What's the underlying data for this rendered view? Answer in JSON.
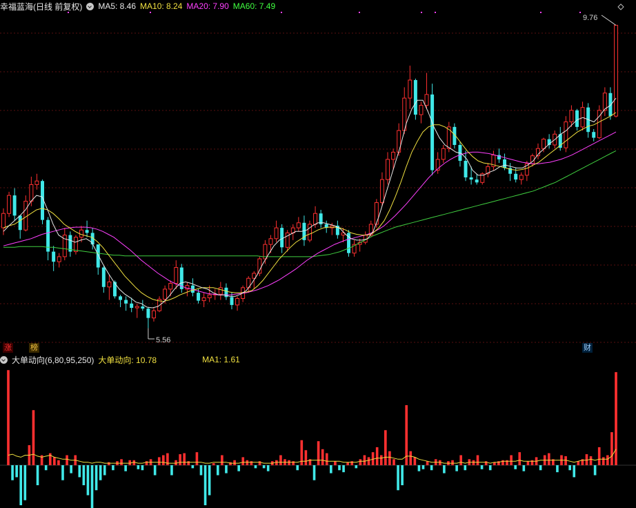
{
  "header": {
    "title": "幸福蓝海(日线 前复权)",
    "ma5": "MA5: 8.46",
    "ma10": "MA10: 8.24",
    "ma20": "MA20: 7.90",
    "ma60": "MA60: 7.49"
  },
  "markers": {
    "zhang": "涨",
    "bang": "榜",
    "cai": "财"
  },
  "price_labels": {
    "high": "9.76",
    "low": "5.56"
  },
  "sub_header": {
    "title": "大单动向(6,80,95,250)",
    "value": "大单动向: 10.78",
    "ma": "MA1: 1.61"
  },
  "colors": {
    "up": "#ff3030",
    "down": "#40e8e8",
    "ma5": "#e8e8e8",
    "ma10": "#f0e040",
    "ma20": "#ff40ff",
    "ma60": "#40d040",
    "grid": "#5a1010"
  },
  "chart_data": {
    "type": "candlestick",
    "ohlc": [
      [
        6.95,
        7.22,
        6.85,
        7.15
      ],
      [
        7.15,
        7.45,
        7.1,
        7.4
      ],
      [
        7.4,
        7.5,
        7.05,
        7.12
      ],
      [
        7.12,
        7.1,
        6.8,
        6.92
      ],
      [
        6.92,
        7.4,
        6.9,
        7.32
      ],
      [
        7.32,
        7.66,
        7.25,
        7.55
      ],
      [
        7.55,
        7.7,
        7.48,
        7.6
      ],
      [
        7.6,
        7.62,
        7.0,
        7.06
      ],
      [
        7.06,
        7.1,
        6.5,
        6.62
      ],
      [
        6.62,
        6.7,
        6.35,
        6.48
      ],
      [
        6.48,
        6.6,
        6.4,
        6.55
      ],
      [
        6.55,
        6.95,
        6.5,
        6.85
      ],
      [
        6.85,
        6.9,
        6.55,
        6.62
      ],
      [
        6.62,
        6.85,
        6.58,
        6.82
      ],
      [
        6.82,
        6.98,
        6.75,
        6.92
      ],
      [
        6.92,
        7.05,
        6.82,
        6.88
      ],
      [
        6.88,
        6.95,
        6.65,
        6.72
      ],
      [
        6.72,
        6.72,
        6.3,
        6.4
      ],
      [
        6.4,
        6.42,
        6.05,
        6.13
      ],
      [
        6.13,
        6.3,
        5.95,
        6.2
      ],
      [
        6.2,
        6.22,
        5.97,
        6.0
      ],
      [
        6.0,
        6.02,
        5.85,
        5.95
      ],
      [
        5.95,
        6.0,
        5.8,
        5.9
      ],
      [
        5.9,
        5.98,
        5.78,
        5.84
      ],
      [
        5.84,
        5.9,
        5.7,
        5.86
      ],
      [
        5.86,
        5.95,
        5.8,
        5.83
      ],
      [
        5.83,
        5.85,
        5.56,
        5.7
      ],
      [
        5.7,
        5.85,
        5.65,
        5.8
      ],
      [
        5.8,
        6.0,
        5.78,
        5.96
      ],
      [
        5.96,
        6.15,
        5.9,
        6.1
      ],
      [
        6.1,
        6.22,
        6.0,
        6.18
      ],
      [
        6.18,
        6.5,
        6.1,
        6.4
      ],
      [
        6.4,
        6.45,
        6.05,
        6.1
      ],
      [
        6.1,
        6.2,
        6.0,
        6.15
      ],
      [
        6.15,
        6.25,
        6.0,
        6.05
      ],
      [
        6.05,
        6.1,
        5.9,
        5.94
      ],
      [
        5.94,
        6.05,
        5.85,
        5.98
      ],
      [
        5.98,
        6.15,
        5.92,
        6.02
      ],
      [
        6.02,
        6.1,
        5.95,
        6.03
      ],
      [
        6.03,
        6.2,
        5.95,
        6.12
      ],
      [
        6.12,
        6.18,
        5.95,
        5.99
      ],
      [
        5.99,
        6.05,
        5.82,
        5.88
      ],
      [
        5.88,
        6.0,
        5.8,
        5.97
      ],
      [
        5.97,
        6.15,
        5.92,
        6.12
      ],
      [
        6.12,
        6.28,
        6.05,
        6.25
      ],
      [
        6.25,
        6.35,
        6.1,
        6.32
      ],
      [
        6.32,
        6.55,
        6.28,
        6.52
      ],
      [
        6.52,
        6.78,
        6.45,
        6.72
      ],
      [
        6.72,
        6.85,
        6.6,
        6.8
      ],
      [
        6.8,
        7.05,
        6.75,
        6.95
      ],
      [
        6.95,
        7.0,
        6.6,
        6.68
      ],
      [
        6.68,
        6.92,
        6.62,
        6.88
      ],
      [
        6.88,
        7.0,
        6.78,
        6.95
      ],
      [
        6.95,
        7.1,
        6.9,
        7.02
      ],
      [
        7.02,
        7.12,
        6.7,
        6.78
      ],
      [
        6.78,
        7.05,
        6.75,
        7.0
      ],
      [
        7.0,
        7.25,
        6.95,
        7.15
      ],
      [
        7.15,
        7.2,
        6.95,
        7.0
      ],
      [
        7.0,
        7.05,
        6.88,
        6.95
      ],
      [
        6.95,
        7.02,
        6.85,
        6.98
      ],
      [
        6.98,
        7.05,
        6.8,
        6.85
      ],
      [
        6.85,
        6.95,
        6.75,
        6.88
      ],
      [
        6.88,
        6.92,
        6.55,
        6.6
      ],
      [
        6.6,
        6.78,
        6.55,
        6.72
      ],
      [
        6.72,
        6.8,
        6.62,
        6.75
      ],
      [
        6.75,
        6.9,
        6.72,
        6.85
      ],
      [
        6.85,
        7.05,
        6.82,
        7.0
      ],
      [
        7.0,
        7.35,
        6.95,
        7.3
      ],
      [
        7.3,
        7.72,
        7.25,
        7.62
      ],
      [
        7.62,
        8.0,
        7.55,
        7.9
      ],
      [
        7.9,
        8.05,
        7.75,
        8.0
      ],
      [
        8.0,
        8.4,
        7.95,
        8.3
      ],
      [
        8.3,
        8.9,
        8.25,
        8.75
      ],
      [
        8.75,
        9.2,
        8.6,
        9.0
      ],
      [
        9.0,
        9.02,
        8.45,
        8.52
      ],
      [
        8.52,
        8.7,
        8.4,
        8.65
      ],
      [
        8.65,
        9.1,
        8.6,
        8.8
      ],
      [
        8.8,
        8.95,
        7.68,
        7.75
      ],
      [
        7.75,
        8.0,
        7.7,
        7.9
      ],
      [
        7.9,
        8.1,
        7.85,
        8.05
      ],
      [
        8.05,
        8.42,
        8.0,
        8.35
      ],
      [
        8.35,
        8.4,
        8.05,
        8.1
      ],
      [
        8.1,
        8.15,
        7.8,
        7.88
      ],
      [
        7.88,
        8.02,
        7.6,
        7.65
      ],
      [
        7.65,
        7.8,
        7.55,
        7.62
      ],
      [
        7.62,
        7.7,
        7.55,
        7.58
      ],
      [
        7.58,
        7.72,
        7.55,
        7.7
      ],
      [
        7.7,
        7.85,
        7.65,
        7.8
      ],
      [
        7.8,
        8.02,
        7.75,
        7.96
      ],
      [
        7.96,
        8.05,
        7.85,
        7.9
      ],
      [
        7.9,
        7.98,
        7.75,
        7.78
      ],
      [
        7.78,
        7.85,
        7.6,
        7.7
      ],
      [
        7.7,
        7.78,
        7.58,
        7.62
      ],
      [
        7.62,
        7.72,
        7.55,
        7.68
      ],
      [
        7.68,
        7.88,
        7.6,
        7.84
      ],
      [
        7.84,
        7.98,
        7.8,
        7.95
      ],
      [
        7.95,
        8.12,
        7.9,
        8.05
      ],
      [
        8.05,
        8.2,
        8.0,
        8.18
      ],
      [
        8.18,
        8.25,
        8.05,
        8.1
      ],
      [
        8.1,
        8.3,
        8.05,
        8.25
      ],
      [
        8.25,
        8.35,
        8.02,
        8.06
      ],
      [
        8.06,
        8.5,
        8.0,
        8.42
      ],
      [
        8.42,
        8.65,
        8.35,
        8.58
      ],
      [
        8.58,
        8.6,
        8.3,
        8.35
      ],
      [
        8.35,
        8.7,
        8.3,
        8.62
      ],
      [
        8.62,
        8.68,
        8.2,
        8.28
      ],
      [
        8.28,
        8.32,
        8.15,
        8.2
      ],
      [
        8.2,
        8.65,
        8.18,
        8.58
      ],
      [
        8.58,
        8.9,
        8.5,
        8.82
      ],
      [
        8.82,
        8.9,
        8.45,
        8.5
      ],
      [
        8.5,
        9.76,
        8.48,
        9.76
      ]
    ],
    "ma5": [
      6.9,
      6.98,
      7.05,
      7.12,
      7.2,
      7.32,
      7.4,
      7.38,
      7.2,
      7.0,
      6.85,
      6.8,
      6.78,
      6.75,
      6.78,
      6.8,
      6.75,
      6.6,
      6.45,
      6.32,
      6.2,
      6.1,
      6.03,
      5.98,
      5.92,
      5.9,
      5.85,
      5.84,
      5.86,
      5.92,
      6.0,
      6.1,
      6.18,
      6.2,
      6.18,
      6.15,
      6.12,
      6.1,
      6.05,
      6.02,
      6.02,
      6.0,
      6.0,
      6.03,
      6.08,
      6.18,
      6.3,
      6.45,
      6.58,
      6.7,
      6.78,
      6.82,
      6.86,
      6.9,
      6.9,
      6.92,
      6.98,
      7.02,
      7.02,
      7.0,
      6.98,
      6.94,
      6.86,
      6.8,
      6.78,
      6.78,
      6.8,
      6.9,
      7.1,
      7.35,
      7.6,
      7.85,
      8.1,
      8.4,
      8.6,
      8.72,
      8.72,
      8.55,
      8.35,
      8.2,
      8.1,
      8.05,
      8.0,
      7.98,
      7.9,
      7.75,
      7.68,
      7.68,
      7.72,
      7.75,
      7.8,
      7.82,
      7.8,
      7.78,
      7.78,
      7.82,
      7.88,
      7.98,
      8.05,
      8.12,
      8.18,
      8.25,
      8.3,
      8.38,
      8.45,
      8.48,
      8.45,
      8.42,
      8.5,
      8.6,
      8.65,
      8.75
    ],
    "ma10": [
      6.95,
      6.98,
      7.0,
      7.05,
      7.1,
      7.15,
      7.2,
      7.22,
      7.2,
      7.15,
      7.08,
      7.0,
      6.95,
      6.9,
      6.86,
      6.84,
      6.82,
      6.76,
      6.68,
      6.58,
      6.48,
      6.38,
      6.28,
      6.2,
      6.12,
      6.05,
      6.0,
      5.96,
      5.94,
      5.93,
      5.95,
      5.98,
      6.02,
      6.05,
      6.08,
      6.1,
      6.12,
      6.12,
      6.12,
      6.1,
      6.08,
      6.06,
      6.05,
      6.05,
      6.06,
      6.08,
      6.14,
      6.22,
      6.32,
      6.42,
      6.52,
      6.6,
      6.68,
      6.75,
      6.8,
      6.85,
      6.88,
      6.92,
      6.95,
      6.96,
      6.96,
      6.95,
      6.92,
      6.88,
      6.86,
      6.85,
      6.85,
      6.88,
      6.95,
      7.05,
      7.2,
      7.38,
      7.58,
      7.8,
      8.0,
      8.15,
      8.28,
      8.35,
      8.38,
      8.38,
      8.35,
      8.3,
      8.22,
      8.12,
      8.02,
      7.94,
      7.88,
      7.85,
      7.84,
      7.82,
      7.8,
      7.78,
      7.76,
      7.75,
      7.76,
      7.78,
      7.82,
      7.86,
      7.92,
      7.98,
      8.04,
      8.1,
      8.16,
      8.22,
      8.28,
      8.32,
      8.36,
      8.38,
      8.42,
      8.46,
      8.5,
      8.55
    ],
    "ma20": [
      6.7,
      6.72,
      6.74,
      6.76,
      6.78,
      6.8,
      6.83,
      6.86,
      6.88,
      6.9,
      6.92,
      6.94,
      6.95,
      6.96,
      6.96,
      6.96,
      6.95,
      6.93,
      6.9,
      6.86,
      6.82,
      6.76,
      6.7,
      6.64,
      6.57,
      6.5,
      6.44,
      6.38,
      6.32,
      6.27,
      6.22,
      6.18,
      6.15,
      6.12,
      6.1,
      6.08,
      6.06,
      6.04,
      6.03,
      6.02,
      6.02,
      6.02,
      6.03,
      6.04,
      6.05,
      6.07,
      6.09,
      6.12,
      6.15,
      6.19,
      6.23,
      6.28,
      6.33,
      6.38,
      6.44,
      6.5,
      6.55,
      6.6,
      6.64,
      6.68,
      6.72,
      6.75,
      6.78,
      6.8,
      6.82,
      6.84,
      6.86,
      6.89,
      6.93,
      6.98,
      7.05,
      7.12,
      7.2,
      7.28,
      7.37,
      7.46,
      7.55,
      7.64,
      7.72,
      7.79,
      7.85,
      7.9,
      7.94,
      7.97,
      7.99,
      8.0,
      8.0,
      7.99,
      7.98,
      7.96,
      7.94,
      7.92,
      7.9,
      7.88,
      7.86,
      7.85,
      7.84,
      7.84,
      7.85,
      7.86,
      7.88,
      7.9,
      7.93,
      7.96,
      8.0,
      8.04,
      8.08,
      8.12,
      8.16,
      8.2,
      8.24,
      8.28
    ],
    "ma60": [
      6.68,
      6.68,
      6.68,
      6.69,
      6.69,
      6.69,
      6.69,
      6.69,
      6.68,
      6.68,
      6.67,
      6.66,
      6.65,
      6.64,
      6.63,
      6.62,
      6.61,
      6.6,
      6.59,
      6.58,
      6.57,
      6.57,
      6.56,
      6.56,
      6.56,
      6.56,
      6.56,
      6.56,
      6.56,
      6.56,
      6.56,
      6.56,
      6.56,
      6.56,
      6.56,
      6.56,
      6.56,
      6.56,
      6.56,
      6.56,
      6.56,
      6.56,
      6.56,
      6.56,
      6.56,
      6.56,
      6.56,
      6.55,
      6.55,
      6.55,
      6.55,
      6.55,
      6.55,
      6.55,
      6.55,
      6.55,
      6.55,
      6.56,
      6.57,
      6.58,
      6.6,
      6.62,
      6.65,
      6.68,
      6.72,
      6.76,
      6.8,
      6.84,
      6.87,
      6.9,
      6.93,
      6.96,
      6.98,
      7.0,
      7.02,
      7.04,
      7.06,
      7.08,
      7.1,
      7.12,
      7.14,
      7.16,
      7.18,
      7.2,
      7.22,
      7.24,
      7.26,
      7.28,
      7.3,
      7.32,
      7.34,
      7.36,
      7.38,
      7.4,
      7.42,
      7.44,
      7.46,
      7.49,
      7.52,
      7.55,
      7.58,
      7.62,
      7.66,
      7.7,
      7.74,
      7.78,
      7.82,
      7.86,
      7.9,
      7.94,
      7.98,
      8.02
    ],
    "flow": [
      9.5,
      -1.5,
      -1.2,
      -4.0,
      -3.5,
      2.0,
      5.5,
      -2.0,
      1.0,
      -0.5,
      1.2,
      0.8,
      0.5,
      -1.5,
      1.0,
      -0.8,
      1.0,
      -1.2,
      -2.0,
      -3.0,
      -4.5,
      -2.5,
      -1.5,
      -1.0,
      0.3,
      -0.5,
      0.4,
      0.6,
      -0.6,
      0.5,
      0.5,
      -0.4,
      -0.5,
      0.4,
      0.6,
      -1.0,
      0.8,
      1.0,
      1.2,
      -1.0,
      0.5,
      1.1,
      1.2,
      0.4,
      -0.3,
      1.3,
      -1.0,
      -4.0,
      -3.0,
      0.2,
      -1.0,
      1.0,
      -0.8,
      0.3,
      0.5,
      -0.6,
      0.8,
      0.5,
      0.4,
      -0.3,
      0.4,
      -0.3,
      -0.6,
      0.4,
      0.5,
      1.0,
      0.6,
      0.5,
      0.4,
      -0.5,
      2.5,
      1.5,
      0.6,
      -1.5,
      2.4,
      1.6,
      1.2,
      -0.8,
      0.4,
      -0.5,
      -0.7,
      0.3,
      0.4,
      -0.3,
      0.6,
      1.0,
      0.8,
      1.3,
      1.8,
      1.0,
      3.5,
      1.4,
      0.6,
      -2.5,
      -2.0,
      6.0,
      1.4,
      0.8,
      -0.6,
      -0.4,
      0.4,
      -0.5,
      0.6,
      0.5,
      -0.8,
      0.4,
      0.5,
      -0.6,
      1.0,
      -0.5,
      0.6,
      0.5,
      1.0,
      -0.4,
      0.4,
      -0.5,
      0.3,
      0.4,
      0.5,
      0.5,
      1.0,
      -0.4,
      1.3,
      -0.6,
      0.4,
      0.5,
      0.8,
      -0.5,
      1.0,
      1.2,
      0.6,
      -0.7,
      1.0,
      0.9,
      -0.5,
      -1.2,
      0.4,
      0.6,
      1.1,
      0.9,
      -1.0,
      1.8,
      0.8,
      1.0,
      3.3,
      9.3
    ],
    "flow_ma": [
      1.0,
      1.1,
      0.9,
      0.8,
      1.0,
      1.0,
      1.1,
      0.9,
      0.8,
      0.9,
      1.0,
      0.8,
      0.7,
      0.6,
      0.6,
      0.5,
      0.5,
      0.4,
      0.3,
      0.3,
      0.2,
      0.3,
      0.3,
      0.2,
      0.2,
      0.2,
      0.2,
      0.2,
      0.2,
      0.2,
      0.3,
      0.2,
      0.2,
      0.3,
      0.3,
      0.3,
      0.3,
      0.3,
      0.2,
      0.2,
      0.2,
      0.3,
      0.3,
      0.3,
      0.3,
      0.3,
      0.3,
      0.2,
      0.2,
      0.3,
      0.3,
      0.3,
      0.3,
      0.2,
      0.2,
      0.2,
      0.3,
      0.3,
      0.3,
      0.3,
      0.3,
      0.2,
      0.2,
      0.2,
      0.3,
      0.3,
      0.3,
      0.3,
      0.3,
      0.3,
      0.4,
      0.4,
      0.5,
      0.5,
      0.5,
      0.5,
      0.4,
      0.4,
      0.4,
      0.4,
      0.3,
      0.3,
      0.3,
      0.3,
      0.4,
      0.4,
      0.5,
      0.6,
      0.7,
      0.7,
      0.8,
      0.8,
      0.7,
      0.6,
      0.6,
      0.9,
      0.9,
      0.8,
      0.6,
      0.5,
      0.4,
      0.3,
      0.3,
      0.3,
      0.2,
      0.2,
      0.2,
      0.2,
      0.3,
      0.2,
      0.3,
      0.3,
      0.3,
      0.3,
      0.3,
      0.2,
      0.3,
      0.3,
      0.4,
      0.4,
      0.4,
      0.4,
      0.5,
      0.4,
      0.4,
      0.4,
      0.4,
      0.5,
      0.5,
      0.5,
      0.5,
      0.5,
      0.5,
      0.5,
      0.4,
      0.3,
      0.4,
      0.5,
      0.5,
      0.6,
      0.5,
      0.6,
      0.6,
      0.6,
      0.9,
      1.6
    ]
  }
}
